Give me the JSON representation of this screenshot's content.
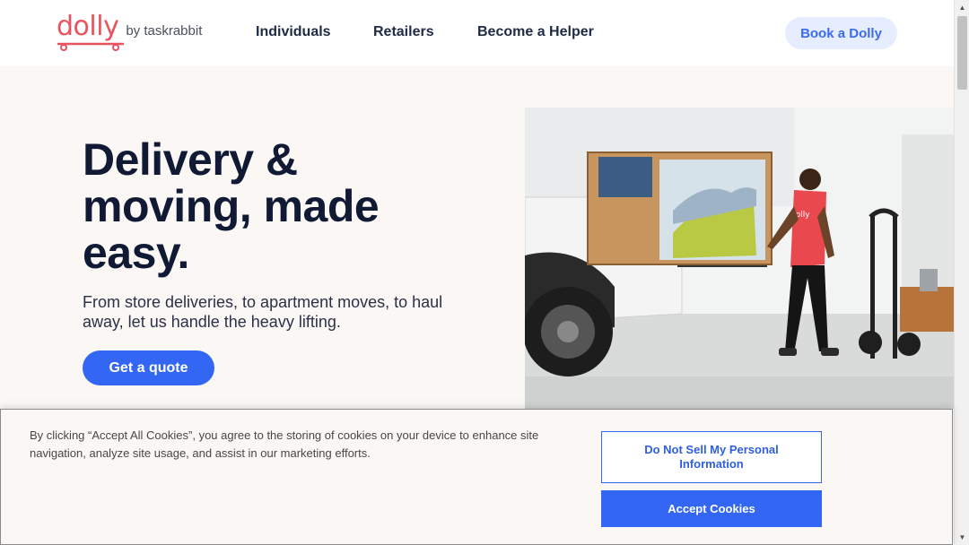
{
  "header": {
    "logo_word": "dolly",
    "logo_by": "by taskrabbit",
    "nav": [
      "Individuals",
      "Retailers",
      "Become a Helper"
    ],
    "book_button": "Book a Dolly",
    "brand_color": "#e8535f",
    "accent_color": "#3366f2"
  },
  "hero": {
    "title": "Delivery & moving, made easy.",
    "subtitle": "From store deliveries, to apartment moves, to haul away, let us handle the heavy lifting.",
    "cta": "Get a quote",
    "image_shirt_text": "dolly"
  },
  "cookie_banner": {
    "text": "By clicking “Accept All Cookies”, you agree to the storing of cookies on your device to enhance site navigation, analyze site usage, and assist in our marketing efforts.",
    "do_not_sell": "Do Not Sell My Personal Information",
    "accept": "Accept Cookies"
  },
  "scrollbar": {
    "up_icon": "arrow-up-icon",
    "down_icon": "arrow-down-icon"
  }
}
